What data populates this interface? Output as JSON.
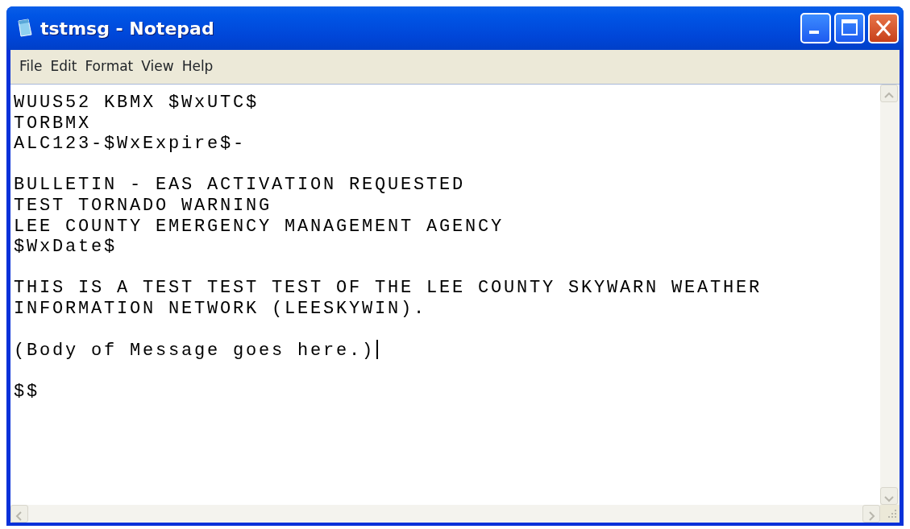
{
  "window": {
    "title": "tstmsg - Notepad"
  },
  "menu": [
    "File",
    "Edit",
    "Format",
    "View",
    "Help"
  ],
  "document": {
    "paragraphs": [
      [
        "WUUS52 KBMX $WxUTC$",
        "TORBMX",
        "ALC123-$WxExpire$-"
      ],
      [
        "BULLETIN - EAS ACTIVATION REQUESTED",
        "TEST TORNADO WARNING",
        "LEE COUNTY EMERGENCY MANAGEMENT AGENCY",
        "$WxDate$"
      ],
      [
        "THIS IS A TEST TEST TEST OF THE LEE COUNTY SKYWARN WEATHER",
        "INFORMATION NETWORK (LEESKYWIN)."
      ],
      [
        "(Body of Message goes here.)"
      ],
      [
        "$$"
      ]
    ]
  }
}
